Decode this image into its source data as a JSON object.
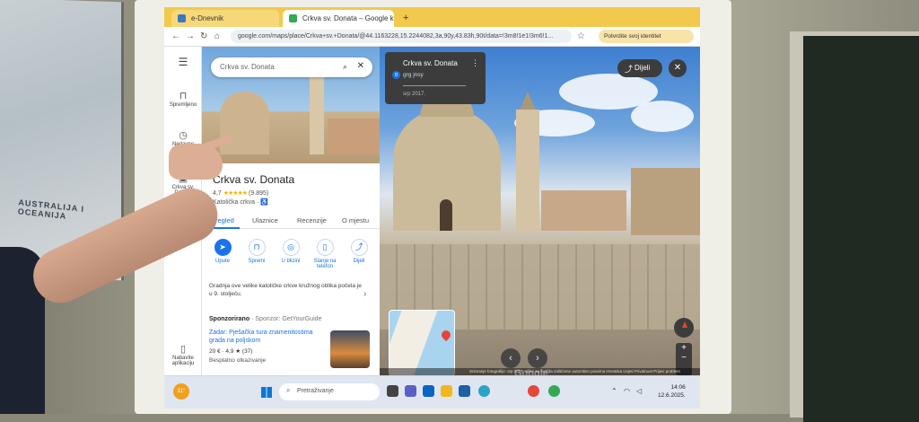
{
  "browser": {
    "tabs": [
      {
        "label": "e-Dnevnik",
        "active": false
      },
      {
        "label": "Crkva sv. Donata – Google kar",
        "active": true
      }
    ],
    "new_tab": "+",
    "url": "google.com/maps/place/Crkva+sv.+Donata/@44.1163228,15.2244082,3a,90y,43.83h,90t/data=!3m8!1e1!3m6!1...",
    "profile_button": "Potvrdite svoj identitet"
  },
  "rail": {
    "menu_icon": "menu-icon",
    "items": [
      {
        "label": "Spremljeno",
        "icon": "bookmark-icon"
      },
      {
        "label": "Nedavno",
        "icon": "history-icon"
      },
      {
        "label": "Crkva sv. Donata",
        "icon": "place-icon"
      },
      {
        "label": "Nabavite aplikaciju",
        "icon": "phone-icon"
      }
    ]
  },
  "panel": {
    "search_value": "Crkva sv. Donata",
    "title": "Crkva sv. Donata",
    "rating": "4,7",
    "rating_stars": "★★★★★",
    "rating_count": "(9.895)",
    "category": "Katolička crkva · ♿",
    "tabs": [
      "Pregled",
      "Ulaznice",
      "Recenzije",
      "O mjestu"
    ],
    "actions": [
      {
        "label": "Upute",
        "icon": "directions-icon",
        "glyph": "➤"
      },
      {
        "label": "Spremi",
        "icon": "bookmark-icon",
        "glyph": "🔖"
      },
      {
        "label": "U blizini",
        "icon": "nearby-icon",
        "glyph": "◎"
      },
      {
        "label": "Slanje na telefon",
        "icon": "send-to-phone-icon",
        "glyph": "▯"
      },
      {
        "label": "Dijeli",
        "icon": "share-icon",
        "glyph": "⤴"
      }
    ],
    "description": "Gradnja ove velike katoličke crkve kružnog oblika počela je u 9. stoljeću.",
    "sponsored_label": "Sponzorirano",
    "sponsored_by": "· Sponzor: GetYourGuide",
    "ad_title": "Zadar: Pješačka tura znamenitostima grada na poljskom",
    "ad_price": "20 € · 4,9 ★ (37)",
    "ad_cancel": "Besplatno otkazivanje"
  },
  "streetview": {
    "card_title": "Crkva sv. Donata",
    "card_user": "grg jnsy",
    "card_user_initial": "g",
    "card_date": "srp 2017.",
    "share_label": "Dijeli",
    "close_glyph": "✕",
    "google_logo": "Google",
    "footer": "Snimanje fotografije: srp 2017.   Slike su možda zaštićene autorskim pravima   Hrvatska   Uvjeti   Privatnost   Prijavi problem",
    "zoom_in": "+",
    "zoom_out": "−"
  },
  "taskbar": {
    "weather": "31°",
    "search_placeholder": "Pretraživanje",
    "time": "14:06",
    "date": "12.6.2025."
  }
}
